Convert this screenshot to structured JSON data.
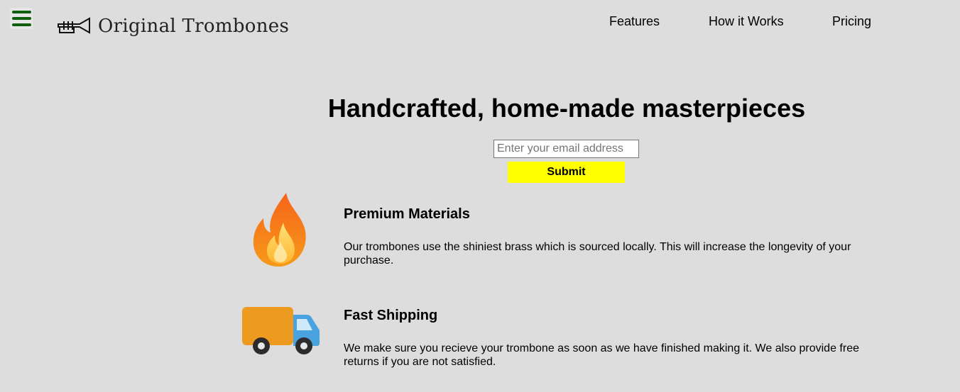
{
  "header": {
    "brand_name": "Original Trombones",
    "nav": [
      "Features",
      "How it Works",
      "Pricing"
    ]
  },
  "hero": {
    "title": "Handcrafted, home-made masterpieces",
    "email_placeholder": "Enter your email address",
    "submit_label": "Submit"
  },
  "features": [
    {
      "icon": "fire-icon",
      "title": "Premium Materials",
      "description": "Our trombones use the shiniest brass which is sourced locally. This will increase the longevity of your purchase."
    },
    {
      "icon": "delivery-truck-icon",
      "title": "Fast Shipping",
      "description": "We make sure you recieve your trombone as soon as we have finished making it. We also provide free returns if you are not satisfied."
    }
  ],
  "colors": {
    "background": "#dddddd",
    "hamburger": "#0e5f0e",
    "submit_button": "#ffff00",
    "fire_outer": "#f06a14",
    "fire_inner": "#ffd24a",
    "truck_body": "#f5a623",
    "truck_cab": "#4aa3df"
  }
}
